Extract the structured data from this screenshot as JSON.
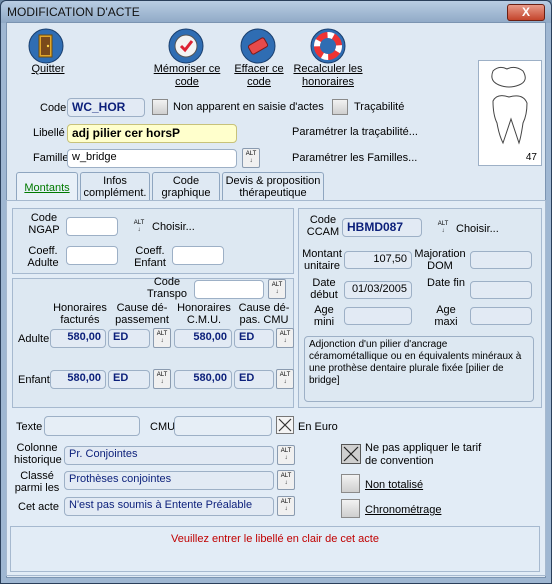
{
  "window": {
    "title": "MODIFICATION D'ACTE",
    "close": "X"
  },
  "toolbar": {
    "quit": "Quitter",
    "memorize": "Mémoriser ce code",
    "erase": "Effacer ce code",
    "recalc": "Recalculer les honoraires"
  },
  "header": {
    "code_label": "Code",
    "code_value": "WC_HOR",
    "non_apparent": "Non apparent en saisie d'actes",
    "tracabilite": "Traçabilité",
    "libelle_label": "Libellé",
    "libelle_value": "adj pilier cer horsP",
    "param_trac": "Paramétrer la traçabilité...",
    "famille_label": "Famille",
    "famille_value": "w_bridge",
    "param_fam": "Paramétrer les Familles...",
    "tooth_number": "47"
  },
  "tabs": [
    "Montants",
    "Infos complément.",
    "Code graphique",
    "Devis & proposition thérapeutique"
  ],
  "ngap": {
    "code_label": "Code NGAP",
    "choisir": "Choisir...",
    "coeff_adulte": "Coeff. Adulte",
    "coeff_enfant": "Coeff. Enfant"
  },
  "honoraires": {
    "code_transpo": "Code Transpo",
    "col_hon_fact": "Honoraires facturés",
    "col_cause_dep": "Cause dé-passement",
    "col_hon_cmu": "Honoraires C.M.U.",
    "col_cause_cmu": "Cause dé-pas. CMU",
    "adulte_label": "Adulte",
    "enfant_label": "Enfant",
    "adulte_fact": "580,00",
    "adulte_cause": "ED",
    "adulte_cmu": "580,00",
    "adulte_cause_cmu": "ED",
    "enfant_fact": "580,00",
    "enfant_cause": "ED",
    "enfant_cmu": "580,00",
    "enfant_cause_cmu": "ED"
  },
  "ccam": {
    "code_label": "Code CCAM",
    "code_value": "HBMD087",
    "choisir": "Choisir...",
    "montant_label": "Montant unitaire",
    "montant_value": "107,50",
    "majoration_label": "Majoration DOM",
    "date_debut_label": "Date début",
    "date_debut_value": "01/03/2005",
    "date_fin_label": "Date fin",
    "age_mini_label": "Age mini",
    "age_maxi_label": "Age maxi",
    "description": "Adjonction d'un pilier d'ancrage céramométallique ou en équivalents minéraux à une prothèse dentaire plurale fixée [pilier de bridge]"
  },
  "bottom": {
    "texte_label": "Texte",
    "cmu_label": "CMU",
    "en_euro": "En Euro",
    "colonne_label": "Colonne historique",
    "colonne_value": "Pr. Conjointes",
    "classe_label": "Classé parmi les",
    "classe_value": "Prothèses conjointes",
    "cet_acte_label": "Cet acte",
    "cet_acte_value": "N'est pas soumis à Entente Préalable",
    "ne_pas_appliquer": "Ne pas appliquer le tarif de convention",
    "non_totalise": "Non totalisé",
    "chrono": "Chronométrage",
    "alt_top": "ALT"
  },
  "status": "Veuillez entrer le libellé en clair de cet acte"
}
